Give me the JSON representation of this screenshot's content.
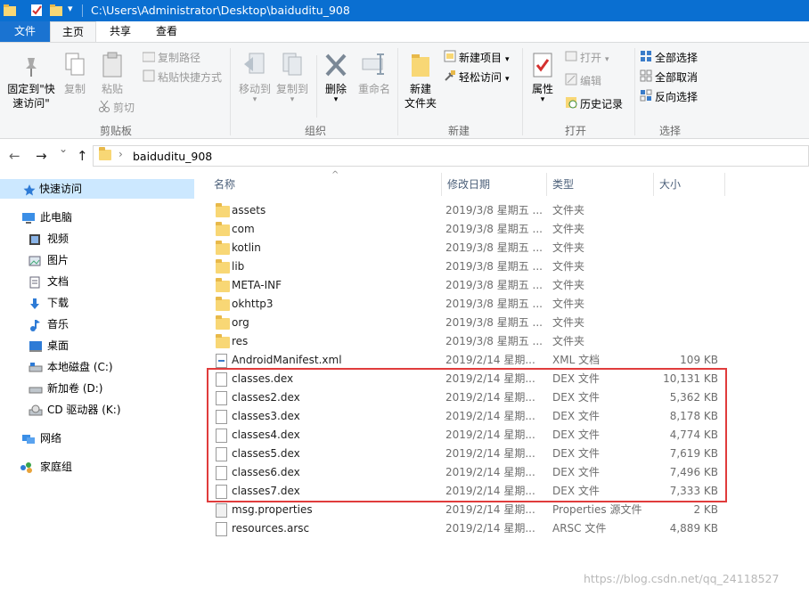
{
  "titlebar": {
    "path": "C:\\Users\\Administrator\\Desktop\\baiduditu_908",
    "dropdown_glyph": "▾"
  },
  "tabs": [
    "文件",
    "主页",
    "共享",
    "查看"
  ],
  "ribbon": {
    "clipboard": {
      "label": "剪贴板",
      "pin": [
        "固定到\"快",
        "速访问\""
      ],
      "copy": "复制",
      "paste": "粘贴",
      "copy_path": "复制路径",
      "paste_shortcut": "粘贴快捷方式",
      "cut": "剪切"
    },
    "organize": {
      "label": "组织",
      "move_to": "移动到",
      "copy_to": "复制到",
      "delete": "删除",
      "rename": "重命名"
    },
    "new": {
      "label": "新建",
      "new_folder": [
        "新建",
        "文件夹"
      ],
      "new_item": "新建项目",
      "easy_access": "轻松访问"
    },
    "open": {
      "label": "打开",
      "properties": "属性",
      "open": "打开",
      "edit": "编辑",
      "history": "历史记录"
    },
    "select": {
      "label": "选择",
      "select_all": "全部选择",
      "select_none": "全部取消",
      "invert": "反向选择"
    }
  },
  "addressbar": {
    "back": "←",
    "forward": "→",
    "recent": "⌄",
    "up": "↑",
    "separator": "›",
    "crumb": "baiduditu_908"
  },
  "navpane": {
    "quick_access": "快速访问",
    "this_pc": "此电脑",
    "videos": "视频",
    "pictures": "图片",
    "documents": "文档",
    "downloads": "下载",
    "music": "音乐",
    "desktop": "桌面",
    "local_disk": "本地磁盘 (C:)",
    "new_volume": "新加卷 (D:)",
    "cd_drive": "CD 驱动器 (K:)",
    "network": "网络",
    "homegroup": "家庭组"
  },
  "columns": {
    "name": "名称",
    "date": "修改日期",
    "type": "类型",
    "size": "大小",
    "sort_glyph": "^"
  },
  "files": [
    {
      "name": "assets",
      "date": "2019/3/8 星期五 ...",
      "type": "文件夹",
      "size": "",
      "icon": "folder-icon"
    },
    {
      "name": "com",
      "date": "2019/3/8 星期五 ...",
      "type": "文件夹",
      "size": "",
      "icon": "folder-icon"
    },
    {
      "name": "kotlin",
      "date": "2019/3/8 星期五 ...",
      "type": "文件夹",
      "size": "",
      "icon": "folder-icon"
    },
    {
      "name": "lib",
      "date": "2019/3/8 星期五 ...",
      "type": "文件夹",
      "size": "",
      "icon": "folder-icon"
    },
    {
      "name": "META-INF",
      "date": "2019/3/8 星期五 ...",
      "type": "文件夹",
      "size": "",
      "icon": "folder-icon"
    },
    {
      "name": "okhttp3",
      "date": "2019/3/8 星期五 ...",
      "type": "文件夹",
      "size": "",
      "icon": "folder-icon"
    },
    {
      "name": "org",
      "date": "2019/3/8 星期五 ...",
      "type": "文件夹",
      "size": "",
      "icon": "folder-icon"
    },
    {
      "name": "res",
      "date": "2019/3/8 星期五 ...",
      "type": "文件夹",
      "size": "",
      "icon": "folder-icon"
    },
    {
      "name": "AndroidManifest.xml",
      "date": "2019/2/14 星期...",
      "type": "XML 文档",
      "size": "109 KB",
      "icon": "xml-file-icon"
    },
    {
      "name": "classes.dex",
      "date": "2019/2/14 星期...",
      "type": "DEX 文件",
      "size": "10,131 KB",
      "icon": "file-icon"
    },
    {
      "name": "classes2.dex",
      "date": "2019/2/14 星期...",
      "type": "DEX 文件",
      "size": "5,362 KB",
      "icon": "file-icon"
    },
    {
      "name": "classes3.dex",
      "date": "2019/2/14 星期...",
      "type": "DEX 文件",
      "size": "8,178 KB",
      "icon": "file-icon"
    },
    {
      "name": "classes4.dex",
      "date": "2019/2/14 星期...",
      "type": "DEX 文件",
      "size": "4,774 KB",
      "icon": "file-icon"
    },
    {
      "name": "classes5.dex",
      "date": "2019/2/14 星期...",
      "type": "DEX 文件",
      "size": "7,619 KB",
      "icon": "file-icon"
    },
    {
      "name": "classes6.dex",
      "date": "2019/2/14 星期...",
      "type": "DEX 文件",
      "size": "7,496 KB",
      "icon": "file-icon"
    },
    {
      "name": "classes7.dex",
      "date": "2019/2/14 星期...",
      "type": "DEX 文件",
      "size": "7,333 KB",
      "icon": "file-icon"
    },
    {
      "name": "msg.properties",
      "date": "2019/2/14 星期...",
      "type": "Properties 源文件",
      "size": "2 KB",
      "icon": "properties-file-icon"
    },
    {
      "name": "resources.arsc",
      "date": "2019/2/14 星期...",
      "type": "ARSC 文件",
      "size": "4,889 KB",
      "icon": "file-icon"
    }
  ],
  "watermark": "https://blog.csdn.net/qq_24118527",
  "colors": {
    "titlebar": "#0a6fd1",
    "file_tab": "#1a73d1",
    "selection": "#cce8ff",
    "highlight_box": "#e03c3c"
  }
}
